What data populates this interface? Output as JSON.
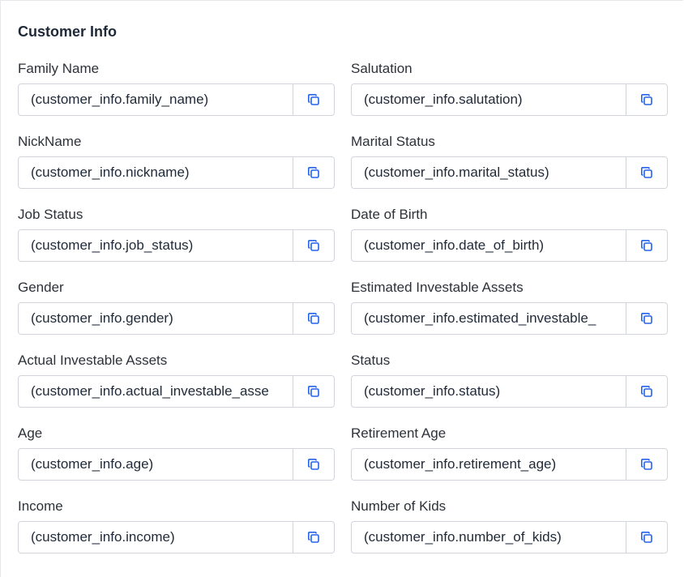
{
  "section": {
    "title": "Customer Info"
  },
  "fields": [
    {
      "label": "Family Name",
      "value": "(customer_info.family_name)"
    },
    {
      "label": "Salutation",
      "value": "(customer_info.salutation)"
    },
    {
      "label": "NickName",
      "value": "(customer_info.nickname)"
    },
    {
      "label": "Marital Status",
      "value": "(customer_info.marital_status)"
    },
    {
      "label": "Job Status",
      "value": "(customer_info.job_status)"
    },
    {
      "label": "Date of Birth",
      "value": "(customer_info.date_of_birth)"
    },
    {
      "label": "Gender",
      "value": "(customer_info.gender)"
    },
    {
      "label": "Estimated Investable Assets",
      "value": "(customer_info.estimated_investable_"
    },
    {
      "label": "Actual Investable Assets",
      "value": "(customer_info.actual_investable_asse"
    },
    {
      "label": "Status",
      "value": "(customer_info.status)"
    },
    {
      "label": "Age",
      "value": "(customer_info.age)"
    },
    {
      "label": "Retirement Age",
      "value": "(customer_info.retirement_age)"
    },
    {
      "label": "Income",
      "value": "(customer_info.income)"
    },
    {
      "label": "Number of Kids",
      "value": "(customer_info.number_of_kids)"
    }
  ],
  "icons": {
    "copy": "copy-icon"
  },
  "colors": {
    "accent": "#2563eb",
    "border": "#d1d5db",
    "text": "#1f2937"
  }
}
